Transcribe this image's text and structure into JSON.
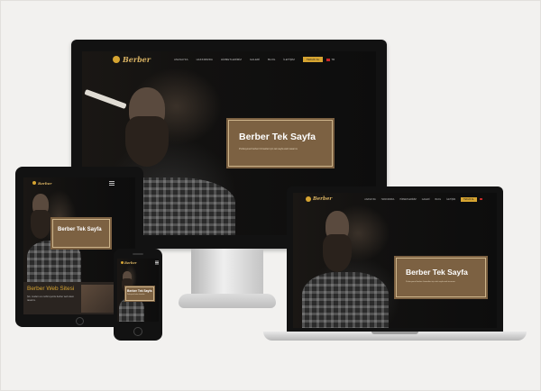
{
  "brand": {
    "logo_text": "Berber"
  },
  "nav": {
    "items": [
      "ANASAYFA",
      "HAKKIMIZDA",
      "HİZMETLERİMİZ",
      "GALERİ",
      "BLOG",
      "İLETİŞİM"
    ],
    "cta_label": "TEKLİF AL",
    "language": "TR"
  },
  "hero": {
    "title": "Berber Tek Sayfa",
    "subtitle": "Profesyonel berber hizmetleri için tek sayfa web tasarımı"
  },
  "tablet": {
    "hero_title": "Berber Tek Sayfa",
    "section_title": "Berber Web Sitesi",
    "section_text": "Şık, modern ve mobil uyumlu berber web sitesi tasarımı."
  },
  "phone": {
    "hero_title": "Berber Tek Sayfa",
    "hero_sub": "Profesyonel berber hizmetleri"
  },
  "colors": {
    "accent": "#d6a431",
    "hero_box": "#7c6142",
    "background": "#f2f1ef"
  }
}
